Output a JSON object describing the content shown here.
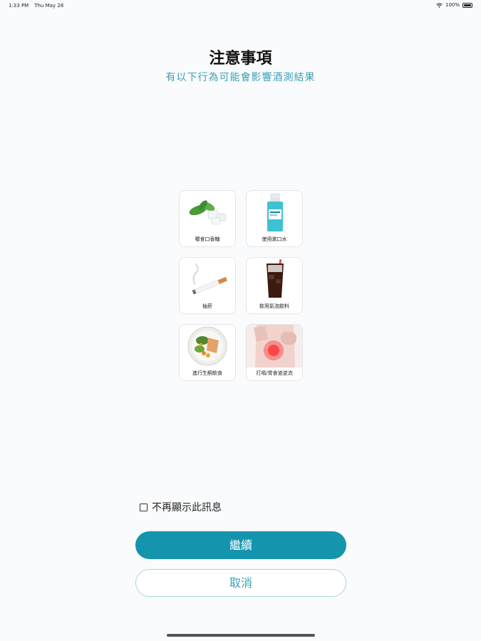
{
  "status_bar": {
    "time": "1:33 PM",
    "date": "Thu May 28",
    "battery": "100%"
  },
  "header": {
    "title": "注意事項",
    "subtitle": "有以下行為可能會影響酒測結果"
  },
  "items": [
    {
      "label": "嚼食口香糖",
      "icon": "gum-mint-icon"
    },
    {
      "label": "使用漱口水",
      "icon": "mouthwash-icon"
    },
    {
      "label": "抽菸",
      "icon": "cigarette-icon"
    },
    {
      "label": "飲用氣泡飲料",
      "icon": "soda-glass-icon"
    },
    {
      "label": "進行生酮飲食",
      "icon": "keto-meal-icon"
    },
    {
      "label": "打嗝/胃食道逆流",
      "icon": "acid-reflux-icon"
    }
  ],
  "checkbox": {
    "label": "不再顯示此訊息",
    "checked": false
  },
  "buttons": {
    "continue": "繼續",
    "cancel": "取消"
  },
  "colors": {
    "accent": "#1594ad",
    "subtitle": "#3aa0b8"
  }
}
